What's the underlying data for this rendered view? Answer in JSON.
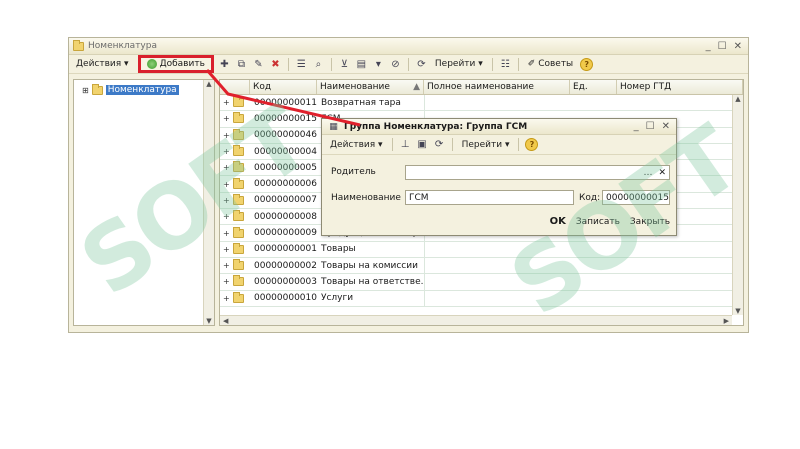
{
  "window": {
    "title": "Номенклатура"
  },
  "toolbar": {
    "actions": "Действия",
    "add": "Добавить",
    "goto": "Перейти",
    "tips": "Советы"
  },
  "tree": {
    "root": "Номенклатура"
  },
  "columns": [
    "Код",
    "Наименование",
    "Полное наименование",
    "Ед.",
    "Номер ГТД"
  ],
  "rows": [
    {
      "code": "00000000011",
      "name": "Возвратная тара"
    },
    {
      "code": "00000000015",
      "name": "ГСМ"
    },
    {
      "code": "00000000046",
      "name": ""
    },
    {
      "code": "00000000004",
      "name": ""
    },
    {
      "code": "00000000005",
      "name": ""
    },
    {
      "code": "00000000006",
      "name": ""
    },
    {
      "code": "00000000007",
      "name": ""
    },
    {
      "code": "00000000008",
      "name": ""
    },
    {
      "code": "00000000009",
      "name": "Продукция из матер..."
    },
    {
      "code": "00000000001",
      "name": "Товары"
    },
    {
      "code": "00000000002",
      "name": "Товары на комиссии"
    },
    {
      "code": "00000000003",
      "name": "Товары на ответстве..."
    },
    {
      "code": "00000000010",
      "name": "Услуги"
    }
  ],
  "dialog": {
    "title": "Группа Номенклатура: Группа ГСМ",
    "actions": "Действия",
    "goto": "Перейти",
    "parent_label": "Родитель",
    "parent_value": "",
    "name_label": "Наименование",
    "name_value": "ГСМ",
    "code_label": "Код:",
    "code_value": "00000000015",
    "ok": "OK",
    "save": "Записать",
    "close": "Закрыть"
  },
  "watermark": "SOFT",
  "colors": {
    "highlight_border": "#d9202c",
    "selection": "#3d7ac7"
  }
}
